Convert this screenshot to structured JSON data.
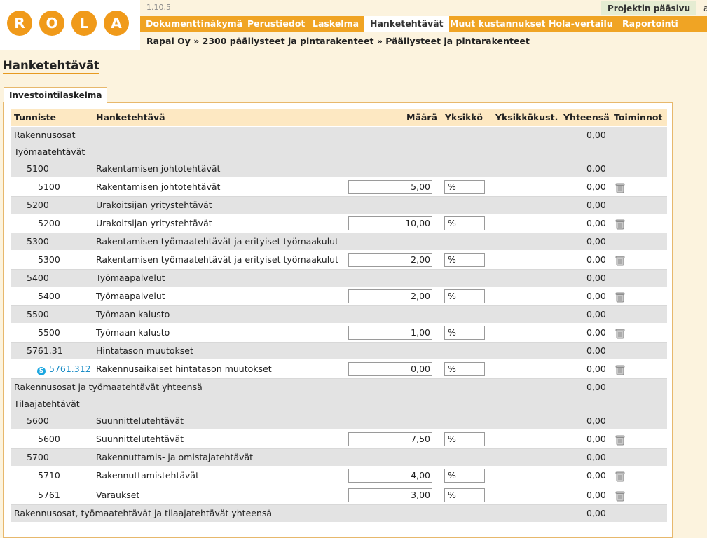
{
  "app": {
    "logo_letters": [
      "R",
      "O",
      "L",
      "A"
    ],
    "version": "1.10.5"
  },
  "top_links": {
    "project_home": "Projektin pääsivu",
    "cut": "a"
  },
  "nav": {
    "tabs": [
      {
        "label": "Dokumenttinäkymä",
        "active": false
      },
      {
        "label": "Perustiedot",
        "active": false
      },
      {
        "label": "Laskelma",
        "active": false
      },
      {
        "label": "Hanketehtävät",
        "active": true
      },
      {
        "label": "Muut kustannukset",
        "active": false
      },
      {
        "label": "Hola-vertailu",
        "active": false
      },
      {
        "label": "Raportointi",
        "active": false
      }
    ]
  },
  "breadcrumb": "Rapal Oy » 2300 päällysteet ja pintarakenteet » Päällysteet ja pintarakenteet",
  "page_title": "Hanketehtävät",
  "subtab": "Investointilaskelma",
  "table": {
    "headers": {
      "id": "Tunniste",
      "task": "Hanketehtävä",
      "qty": "Määrä",
      "unit": "Yksikkö",
      "unit_cost": "Yksikkökust.",
      "total": "Yhteensä",
      "actions": "Toiminnot"
    },
    "rows": [
      {
        "kind": "group",
        "label": "Rakennusosat",
        "total": "0,00"
      },
      {
        "kind": "group",
        "label": "Työmaatehtävät",
        "total": ""
      },
      {
        "kind": "item",
        "id": "5100",
        "task": "Rakentamisen johtotehtävät",
        "total": "0,00"
      },
      {
        "kind": "sub",
        "id": "5100",
        "task": "Rakentamisen johtotehtävät",
        "qty": "5,00",
        "unit": "%",
        "total": "0,00"
      },
      {
        "kind": "item",
        "id": "5200",
        "task": "Urakoitsijan yritystehtävät",
        "total": "0,00"
      },
      {
        "kind": "sub",
        "id": "5200",
        "task": "Urakoitsijan yritystehtävät",
        "qty": "10,00",
        "unit": "%",
        "total": "0,00"
      },
      {
        "kind": "item",
        "id": "5300",
        "task": "Rakentamisen työmaatehtävät ja erityiset työmaakulut",
        "total": "0,00"
      },
      {
        "kind": "sub",
        "id": "5300",
        "task": "Rakentamisen työmaatehtävät ja erityiset työmaakulut",
        "qty": "2,00",
        "unit": "%",
        "total": "0,00"
      },
      {
        "kind": "item",
        "id": "5400",
        "task": "Työmaapalvelut",
        "total": "0,00"
      },
      {
        "kind": "sub",
        "id": "5400",
        "task": "Työmaapalvelut",
        "qty": "2,00",
        "unit": "%",
        "total": "0,00"
      },
      {
        "kind": "item",
        "id": "5500",
        "task": "Työmaan kalusto",
        "total": "0,00"
      },
      {
        "kind": "sub",
        "id": "5500",
        "task": "Työmaan kalusto",
        "qty": "1,00",
        "unit": "%",
        "total": "0,00"
      },
      {
        "kind": "item",
        "id": "5761.31",
        "task": "Hintatason muutokset",
        "total": "0,00"
      },
      {
        "kind": "sub",
        "id": "5761.312",
        "task": "Rakennusaikaiset hintatason muutokset",
        "qty": "0,00",
        "unit": "%",
        "total": "0,00",
        "link": true
      },
      {
        "kind": "total",
        "label": "Rakennusosat ja työmaatehtävät yhteensä",
        "total": "0,00"
      },
      {
        "kind": "group",
        "label": "Tilaajatehtävät",
        "total": ""
      },
      {
        "kind": "item",
        "id": "5600",
        "task": "Suunnittelutehtävät",
        "total": "0,00"
      },
      {
        "kind": "sub",
        "id": "5600",
        "task": "Suunnittelutehtävät",
        "qty": "7,50",
        "unit": "%",
        "total": "0,00"
      },
      {
        "kind": "item",
        "id": "5700",
        "task": "Rakennuttamis- ja omistajatehtävät",
        "total": "0,00"
      },
      {
        "kind": "sub",
        "id": "5710",
        "task": "Rakennuttamistehtävät",
        "qty": "4,00",
        "unit": "%",
        "total": "0,00"
      },
      {
        "kind": "sub",
        "id": "5761",
        "task": "Varaukset",
        "qty": "3,00",
        "unit": "%",
        "total": "0,00"
      },
      {
        "kind": "total",
        "label": "Rakennusosat, työmaatehtävät ja tilaajatehtävät yhteensä",
        "total": "0,00"
      }
    ]
  }
}
